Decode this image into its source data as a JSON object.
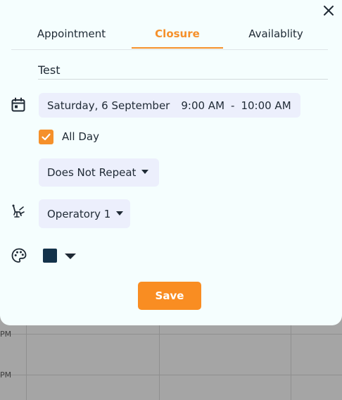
{
  "modal": {
    "tabs": [
      {
        "label": "Appointment"
      },
      {
        "label": "Closure"
      },
      {
        "label": "Availablity"
      }
    ],
    "title_value": "Test",
    "date_text": "Saturday, 6 September",
    "start_time": "9:00 AM",
    "separator": "-",
    "end_time": "10:00 AM",
    "all_day_label": "All Day",
    "all_day_checked": true,
    "repeat_value": "Does Not Repeat",
    "operatory_value": "Operatory 1",
    "color_value": "#13324a",
    "save_label": "Save"
  },
  "background": {
    "time_labels": [
      "PM",
      "PM"
    ]
  },
  "colors": {
    "accent": "#f5902a",
    "pill_bg": "#eceffc",
    "modal_bg": "#f5fefe",
    "overlay": "#a5a5a5"
  },
  "icons": {
    "close": "close-icon",
    "calendar": "calendar-icon",
    "operatory": "dental-chair-icon",
    "color": "palette-icon",
    "check": "check-icon"
  }
}
